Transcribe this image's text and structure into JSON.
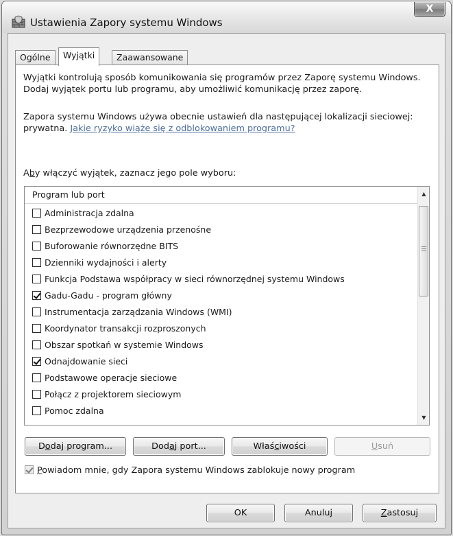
{
  "window": {
    "title": "Ustawienia Zapory systemu Windows",
    "close_glyph": "X",
    "icon": "firewall-icon"
  },
  "tabs": [
    {
      "label": "Ogólne",
      "active": false
    },
    {
      "label": "Wyjątki",
      "active": true
    },
    {
      "label": "Zaawansowane",
      "active": false
    }
  ],
  "description": {
    "para1": "Wyjątki kontrolują sposób komunikowania się programów przez Zaporę systemu Windows. Dodaj wyjątek portu lub programu, aby umożliwić komunikację przez zaporę.",
    "para2": "Zapora systemu Windows używa obecnie ustawień dla następującej lokalizacji sieciowej: prywatna.",
    "link": "Jakie ryzyko wiąże się z odblokowaniem programu?"
  },
  "instruction": {
    "pre": "A",
    "accel": "b",
    "post": "y włączyć wyjątek, zaznacz jego pole wyboru:"
  },
  "list": {
    "header": "Program lub port",
    "items": [
      {
        "label": "Administracja zdalna",
        "checked": false
      },
      {
        "label": "Bezprzewodowe urządzenia przenośne",
        "checked": false
      },
      {
        "label": "Buforowanie równorzędne BITS",
        "checked": false
      },
      {
        "label": "Dzienniki wydajności i alerty",
        "checked": false
      },
      {
        "label": "Funkcja Podstawa współpracy w sieci równorzędnej systemu Windows",
        "checked": false
      },
      {
        "label": "Gadu-Gadu - program główny",
        "checked": true
      },
      {
        "label": "Instrumentacja zarządzania Windows (WMI)",
        "checked": false
      },
      {
        "label": "Koordynator transakcji rozproszonych",
        "checked": false
      },
      {
        "label": "Obszar spotkań w systemie Windows",
        "checked": false
      },
      {
        "label": "Odnajdowanie sieci",
        "checked": true
      },
      {
        "label": "Podstawowe operacje sieciowe",
        "checked": false
      },
      {
        "label": "Połącz z projektorem sieciowym",
        "checked": false
      },
      {
        "label": "Pomoc zdalna",
        "checked": false
      }
    ]
  },
  "actions": {
    "add_program": {
      "pre": "D",
      "accel": "o",
      "post": "daj program..."
    },
    "add_port": {
      "pre": "Dod",
      "accel": "a",
      "post": "j port..."
    },
    "properties": {
      "pre": "Właś",
      "accel": "c",
      "post": "iwości"
    },
    "remove": {
      "pre": "",
      "accel": "U",
      "post": "suń"
    }
  },
  "notify": {
    "checked": true,
    "pre": "",
    "accel": "P",
    "post": "owiadom mnie, gdy Zapora systemu Windows zablokuje nowy program"
  },
  "footer": {
    "ok": "OK",
    "cancel": "Anuluj",
    "apply": {
      "pre": "",
      "accel": "Z",
      "post": "astosuj"
    }
  }
}
